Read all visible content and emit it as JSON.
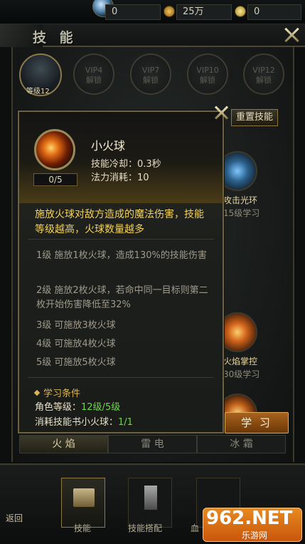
{
  "currency": {
    "value1": "0",
    "value2": "25万",
    "value3": "0"
  },
  "header": {
    "title": "技 能"
  },
  "vip": {
    "avatar_level": "等级12",
    "slots": [
      {
        "top": "VIP4",
        "bottom": "解锁"
      },
      {
        "top": "VIP7",
        "bottom": "解锁"
      },
      {
        "top": "VIP10",
        "bottom": "解锁"
      },
      {
        "top": "VIP12",
        "bottom": "解锁"
      }
    ]
  },
  "reset_button": "重置技能",
  "side_skills": {
    "skill1_label": "攻击光环",
    "skill1_sub": "15级学习",
    "skill2_label": "火焰掌控",
    "skill2_sub": "30级学习"
  },
  "popup": {
    "name": "小火球",
    "count": "0/5",
    "cooldown": "技能冷却：0.3秒",
    "mana": "法力消耗：10",
    "description": "施放火球对敌方造成的魔法伤害，技能等级越高，火球数量越多",
    "levels": [
      "1级 施放1枚火球，造成130%的技能伤害",
      "2级 施放2枚火球，若命中同一目标则第二枚开始伤害降低至32%",
      "3级 可施放3枚火球",
      "4级 可施放4枚火球",
      "5级 可施放5枚火球"
    ],
    "conditions": {
      "title": "学习条件",
      "role_level_label": "角色等级：",
      "role_level_value": "12级/5级",
      "book_label": "消耗技能书小火球：",
      "book_value": "1/1"
    },
    "learn_button": "学 习"
  },
  "element_tabs": [
    "火 焰",
    "雷 电",
    "冰 霜"
  ],
  "bottom_nav": {
    "back": "返回",
    "tab1": "技能",
    "tab2": "技能搭配",
    "tab3": "血"
  },
  "watermark": {
    "big": "962.NET",
    "small": "乐游网"
  },
  "colors": {
    "accent_gold": "#d9b556",
    "desc_yellow": "#f3d25a",
    "green": "#6fd44a",
    "learn_orange": "#a8621e"
  }
}
